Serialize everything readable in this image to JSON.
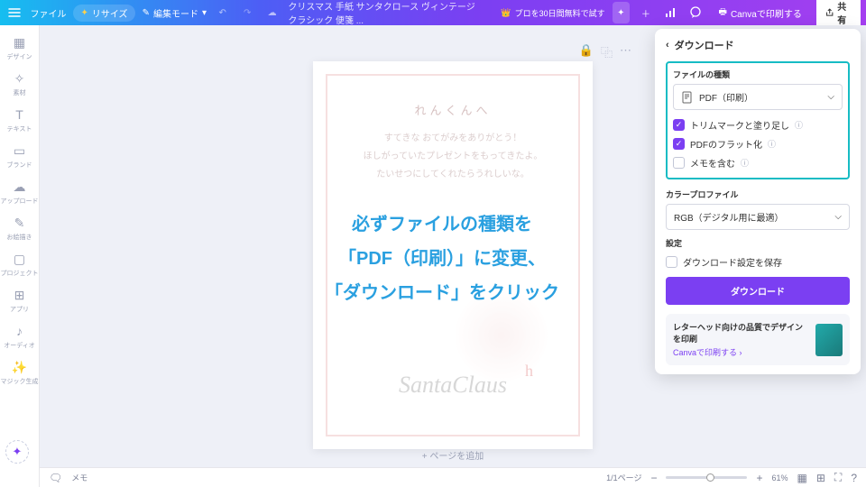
{
  "topbar": {
    "file": "ファイル",
    "resize": "リサイズ",
    "edit_mode": "編集モード",
    "doc_title": "クリスマス 手紙 サンタクロース ヴィンテージ クラシック 便箋 ...",
    "trial": "プロを30日間無料で試す",
    "print": "Canvaで印刷する",
    "share": "共有"
  },
  "sidebar": {
    "items": [
      {
        "label": "デザイン"
      },
      {
        "label": "素材"
      },
      {
        "label": "テキスト"
      },
      {
        "label": "ブランド"
      },
      {
        "label": "アップロード"
      },
      {
        "label": "お絵描き"
      },
      {
        "label": "プロジェクト"
      },
      {
        "label": "アプリ"
      },
      {
        "label": "オーディオ"
      },
      {
        "label": "マジック生成"
      }
    ]
  },
  "canvas": {
    "add_page": "+ ページを追加",
    "letter": {
      "title": "れんくんへ",
      "l1": "すてきな おてがみをありがとう！",
      "l2": "ほしがっていたプレゼントをもってきたよ。",
      "l3": "たいせつにしてくれたらうれしいな。",
      "sig1": "SantaClaus",
      "sig2": "h"
    }
  },
  "panel": {
    "header": "ダウンロード",
    "file_type_label": "ファイルの種類",
    "file_type_value": "PDF（印刷）",
    "opt_trim": "トリムマークと塗り足し",
    "opt_flatten": "PDFのフラット化",
    "opt_memo": "メモを含む",
    "color_profile_label": "カラープロファイル",
    "color_profile_value": "RGB（デジタル用に最適）",
    "settings_label": "設定",
    "save_settings": "ダウンロード設定を保存",
    "download_btn": "ダウンロード",
    "promo_title": "レターヘッド向けの品質でデザインを印刷",
    "promo_link": "Canvaで印刷する"
  },
  "annotation": {
    "l1": "必ずファイルの種類を",
    "l2": "「PDF（印刷）」に変更、",
    "l3": "「ダウンロード」をクリック"
  },
  "bottombar": {
    "memo": "メモ",
    "pages": "1/1ページ",
    "zoom": "61%"
  }
}
